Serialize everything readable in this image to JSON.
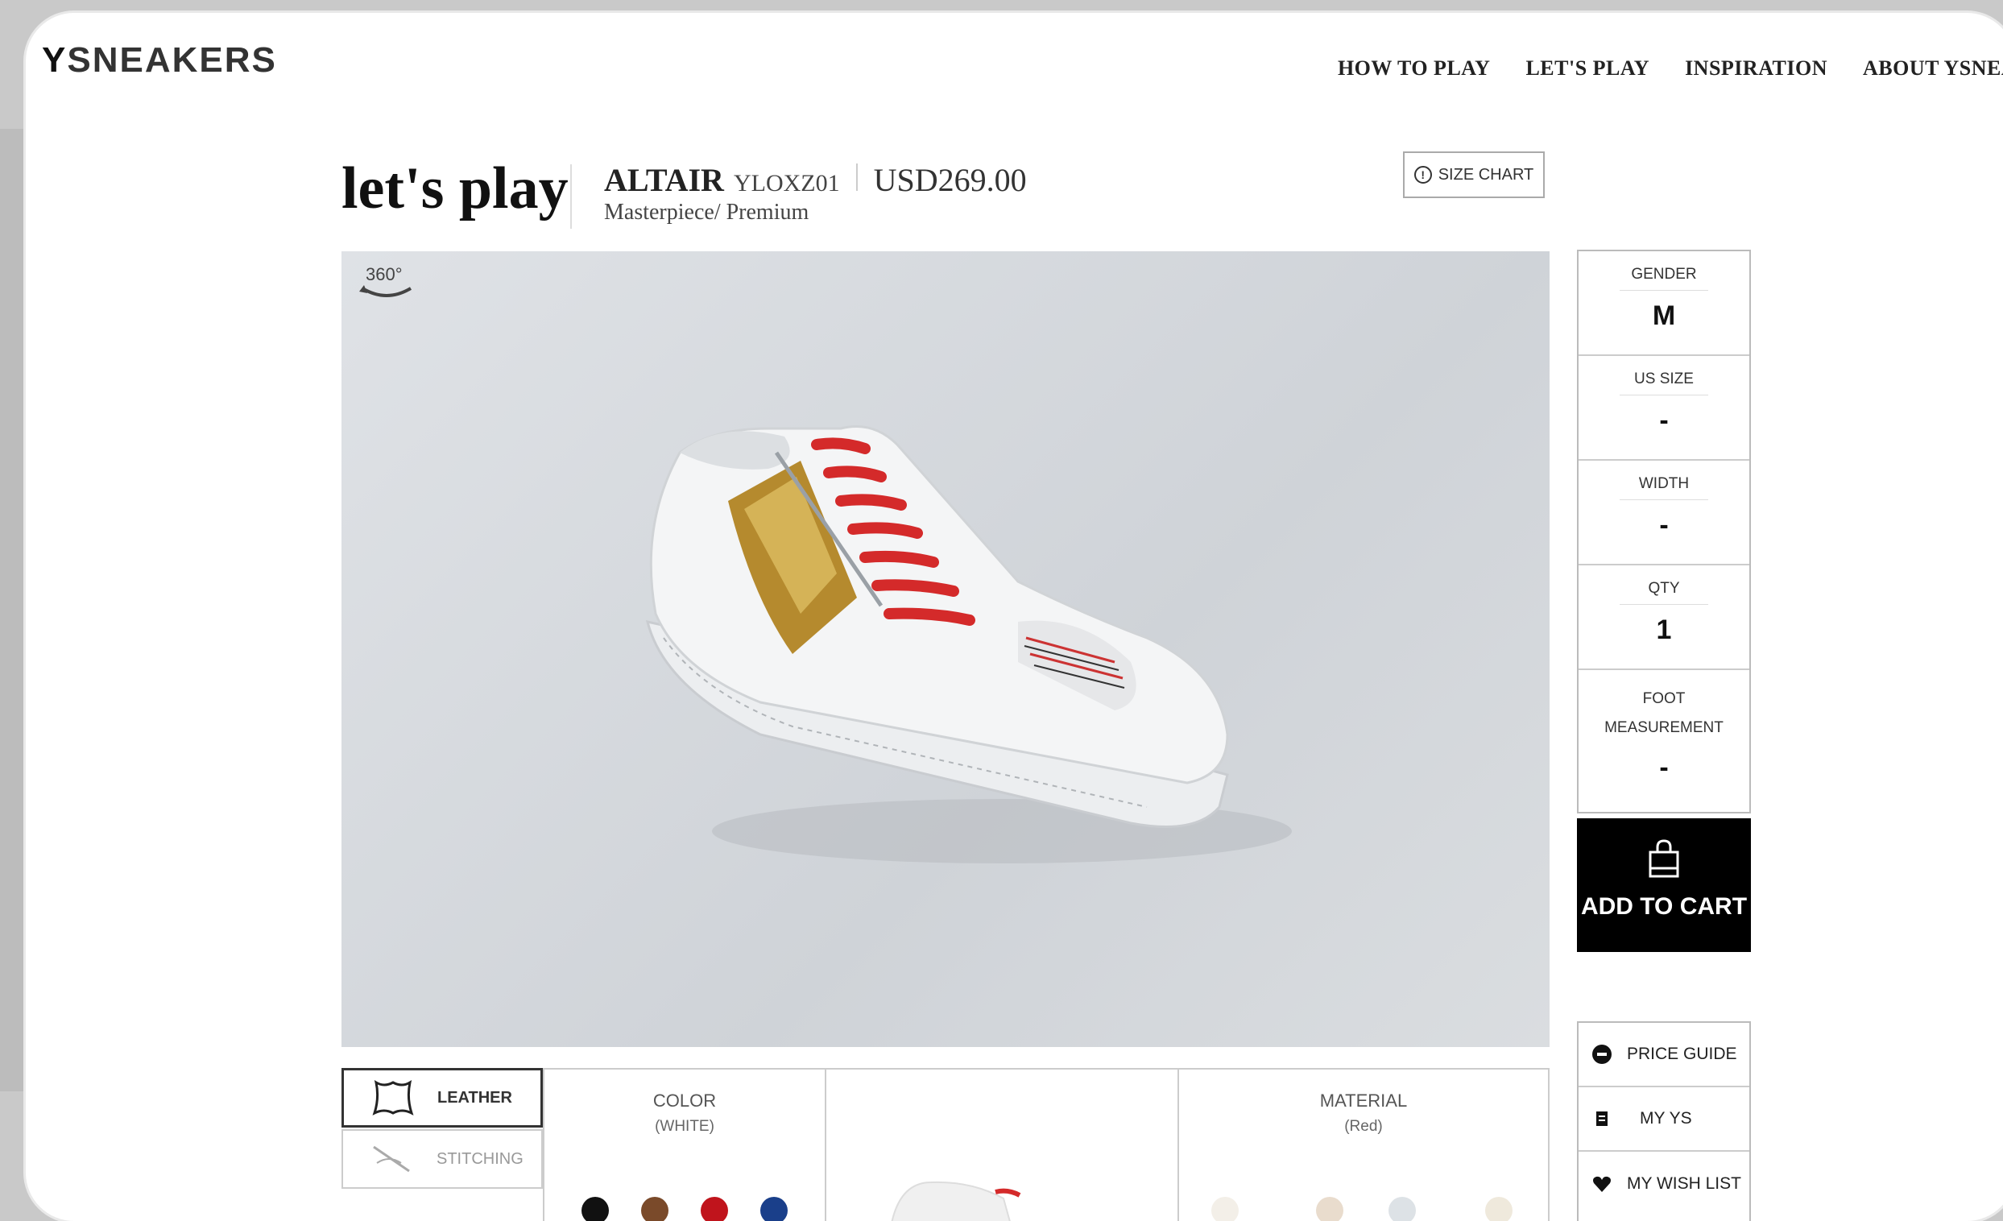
{
  "brand": {
    "logo_prefix": "Y",
    "logo_rest": "SNEAKERS"
  },
  "nav": {
    "items": [
      "HOW TO PLAY",
      "LET'S PLAY",
      "INSPIRATION",
      "ABOUT YSNEAKER"
    ]
  },
  "page": {
    "title": "let's play"
  },
  "product": {
    "name": "ALTAIR",
    "code": "YLOXZ01",
    "price": "USD269.00",
    "line": "Masterpiece/ Premium"
  },
  "size_chart": {
    "label": "SIZE CHART"
  },
  "viewer": {
    "badge": "360°"
  },
  "options": {
    "gender": {
      "label": "GENDER",
      "value": "M"
    },
    "us_size": {
      "label": "US SIZE",
      "value": "-"
    },
    "width": {
      "label": "WIDTH",
      "value": "-"
    },
    "qty": {
      "label": "QTY",
      "value": "1"
    },
    "foot_measurement": {
      "label": "FOOT MEASUREMENT",
      "value": "-"
    }
  },
  "cart": {
    "label": "ADD TO CART"
  },
  "links": {
    "price_guide": "PRICE GUIDE",
    "my_ys": "MY YS",
    "wish_list": "MY WISH LIST"
  },
  "customize": {
    "tabs": {
      "leather": "LEATHER",
      "stitching": "STITCHING"
    },
    "color": {
      "title": "COLOR",
      "value": "(WHITE)"
    },
    "material": {
      "title": "MATERIAL",
      "value": "(Red)"
    },
    "swatch_colors": [
      "#111111",
      "#7a4a2a",
      "#c0141c",
      "#1a3f8a"
    ]
  }
}
